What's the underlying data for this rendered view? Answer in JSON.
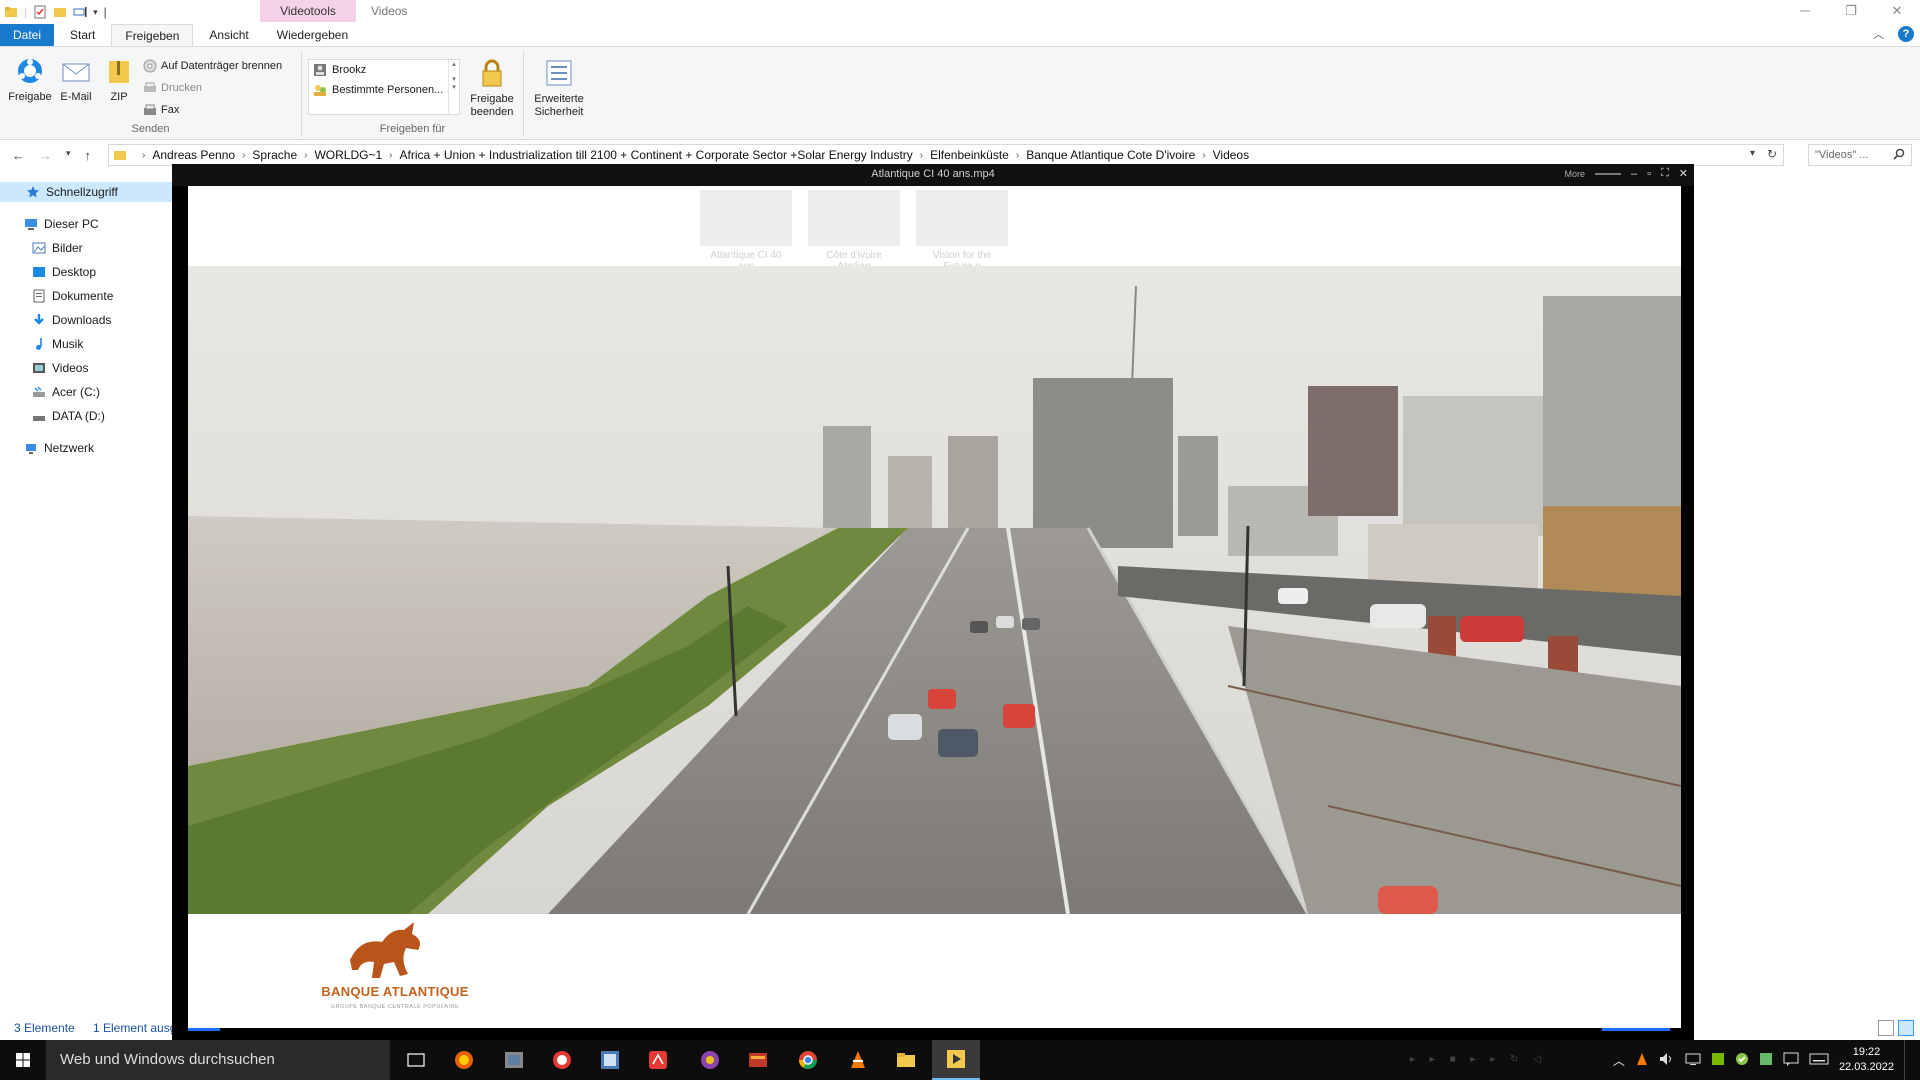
{
  "window": {
    "context_tab": "Videotools",
    "title": "Videos"
  },
  "ribbon_tabs": [
    {
      "label": "Datei"
    },
    {
      "label": "Start"
    },
    {
      "label": "Freigeben"
    },
    {
      "label": "Ansicht"
    },
    {
      "label": "Wiedergeben"
    }
  ],
  "ribbon": {
    "send_group": {
      "label": "Senden",
      "share": "Freigabe",
      "email": "E-Mail",
      "zip": "ZIP",
      "burn": "Auf Datenträger brennen",
      "print": "Drucken",
      "fax": "Fax"
    },
    "share_group": {
      "label": "Freigeben für",
      "items": [
        "Brookz",
        "Bestimmte Personen..."
      ],
      "stop_share_l1": "Freigabe",
      "stop_share_l2": "beenden",
      "advanced_l1": "Erweiterte",
      "advanced_l2": "Sicherheit"
    }
  },
  "address": {
    "crumbs": [
      "Andreas Penno",
      "Sprache",
      "WORLDG~1",
      "Africa + Union + Industrialization till 2100 + Continent + Corporate Sector +Solar Energy Industry",
      "Elfenbeinküste",
      "Banque Atlantique Cote D'ivoire",
      "Videos"
    ],
    "search_placeholder": "\"Videos\" ..."
  },
  "nav_pane": {
    "quick_access": "Schnellzugriff",
    "this_pc": "Dieser PC",
    "items": [
      "Bilder",
      "Desktop",
      "Dokumente",
      "Downloads",
      "Musik",
      "Videos",
      "Acer (C:)",
      "DATA (D:)"
    ],
    "network": "Netzwerk"
  },
  "status_bar": {
    "count": "3 Elemente",
    "selected": "1 Element ausg"
  },
  "files_ghost": [
    {
      "line1": "Atlantique CI 40",
      "line2": "ans"
    },
    {
      "line1": "Côte d'ivoire",
      "line2": "Abidjan"
    },
    {
      "line1": "Vision for the",
      "line2": "Future o"
    }
  ],
  "player": {
    "title": "Atlantique CI 40 ans.mp4",
    "more": "More",
    "logo_name": "BANQUE ATLANTIQUE",
    "logo_sub": "GROUPE BANQUE CENTRALE POPULAIRE"
  },
  "taskbar": {
    "search_placeholder": "Web und Windows durchsuchen",
    "time": "19:22",
    "date": "22.03.2022"
  },
  "colors": {
    "accent": "#1979ca",
    "context_tab": "#f6d2e9",
    "selection": "#cce8ff",
    "logo_orange": "#c2621c"
  }
}
